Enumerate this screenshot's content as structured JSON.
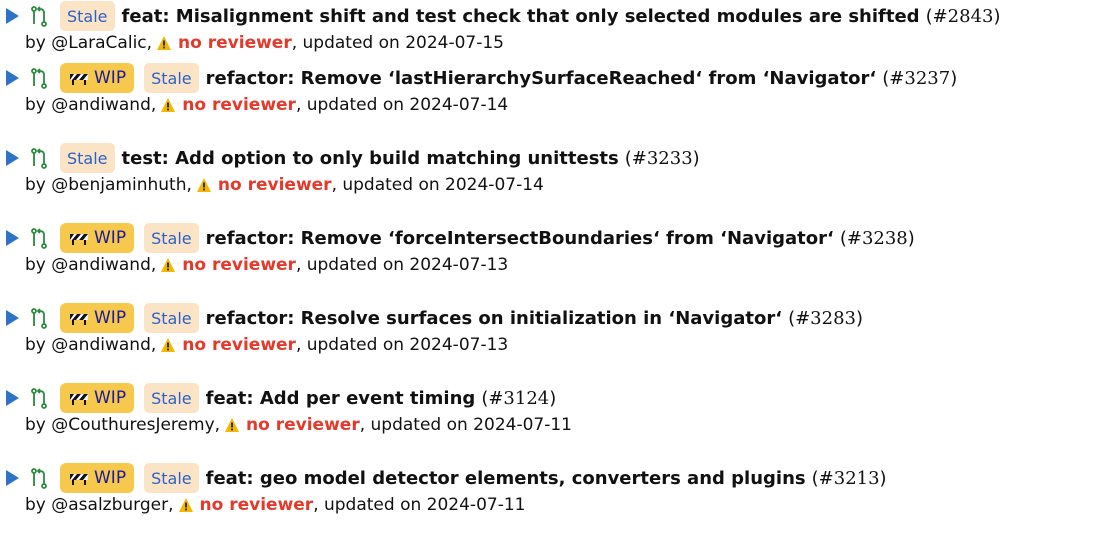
{
  "prs": [
    {
      "wip": false,
      "stale_label": "Stale",
      "title": "feat: Misalignment shift and test check that only selected modules are shifted",
      "number": "#2843",
      "by": "by",
      "author": "@LaraCalic,",
      "reviewer": "no reviewer",
      "updated": ", updated on 2024-07-15"
    },
    {
      "wip": true,
      "wip_label": "WIP",
      "stale_label": "Stale",
      "title": "refactor: Remove ‘lastHierarchySurfaceReached‘ from ‘Navigator‘",
      "number": "#3237",
      "by": "by",
      "author": "@andiwand,",
      "reviewer": "no reviewer",
      "updated": ", updated on 2024-07-14"
    },
    {
      "wip": false,
      "stale_label": "Stale",
      "title": "test: Add option to only build matching unittests",
      "number": "#3233",
      "by": "by",
      "author": "@benjaminhuth,",
      "reviewer": "no reviewer",
      "updated": ", updated on 2024-07-14"
    },
    {
      "wip": true,
      "wip_label": "WIP",
      "stale_label": "Stale",
      "title": "refactor: Remove ‘forceIntersectBoundaries‘ from ‘Navigator‘",
      "number": "#3238",
      "by": "by",
      "author": "@andiwand,",
      "reviewer": "no reviewer",
      "updated": ", updated on 2024-07-13"
    },
    {
      "wip": true,
      "wip_label": "WIP",
      "stale_label": "Stale",
      "title": "refactor: Resolve surfaces on initialization in ‘Navigator‘",
      "number": "#3283",
      "by": "by",
      "author": "@andiwand,",
      "reviewer": "no reviewer",
      "updated": ", updated on 2024-07-13"
    },
    {
      "wip": true,
      "wip_label": "WIP",
      "stale_label": "Stale",
      "title": "feat: Add per event timing",
      "number": "#3124",
      "by": "by",
      "author": "@CouthuresJeremy,",
      "reviewer": "no reviewer",
      "updated": ", updated on 2024-07-11"
    },
    {
      "wip": true,
      "wip_label": "WIP",
      "stale_label": "Stale",
      "title": "feat: geo model detector elements, converters and plugins",
      "number": "#3213",
      "by": "by",
      "author": "@asalzburger,",
      "reviewer": "no reviewer",
      "updated": ", updated on 2024-07-11"
    }
  ],
  "colors": {
    "chevron": "#2f73c9",
    "pr_icon": "#2a8a3e",
    "wip_bg": "#f6c84b",
    "stale_bg": "#fbe3c6",
    "stale_text": "#2b62c5",
    "no_reviewer": "#e4392b",
    "warning": "#f5b800"
  },
  "icons": {
    "expand": "triangle-right-icon",
    "pr": "git-pull-request-icon",
    "wip": "construction-barrier-icon",
    "warning": "warning-triangle-icon"
  }
}
